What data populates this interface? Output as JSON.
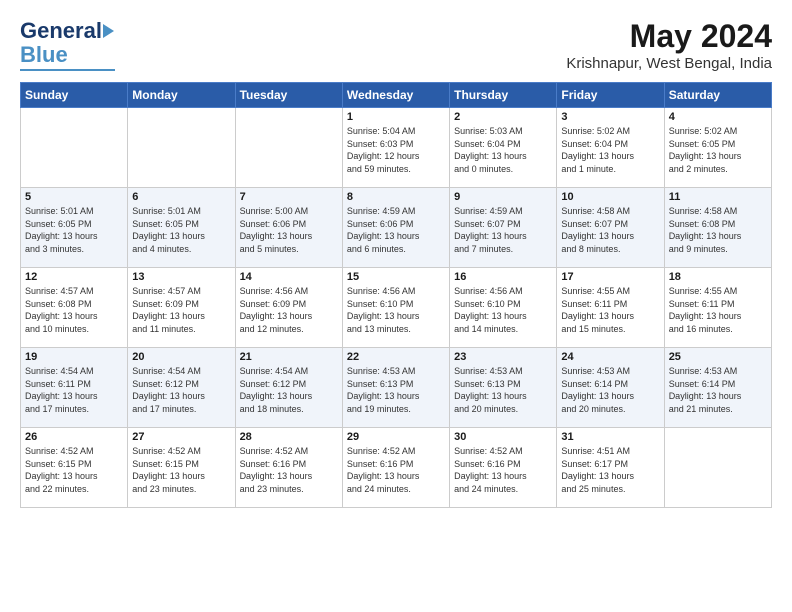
{
  "header": {
    "logo_general": "General",
    "logo_blue": "Blue",
    "title": "May 2024",
    "subtitle": "Krishnapur, West Bengal, India"
  },
  "weekdays": [
    "Sunday",
    "Monday",
    "Tuesday",
    "Wednesday",
    "Thursday",
    "Friday",
    "Saturday"
  ],
  "weeks": [
    [
      {
        "day": "",
        "info": ""
      },
      {
        "day": "",
        "info": ""
      },
      {
        "day": "",
        "info": ""
      },
      {
        "day": "1",
        "info": "Sunrise: 5:04 AM\nSunset: 6:03 PM\nDaylight: 12 hours\nand 59 minutes."
      },
      {
        "day": "2",
        "info": "Sunrise: 5:03 AM\nSunset: 6:04 PM\nDaylight: 13 hours\nand 0 minutes."
      },
      {
        "day": "3",
        "info": "Sunrise: 5:02 AM\nSunset: 6:04 PM\nDaylight: 13 hours\nand 1 minute."
      },
      {
        "day": "4",
        "info": "Sunrise: 5:02 AM\nSunset: 6:05 PM\nDaylight: 13 hours\nand 2 minutes."
      }
    ],
    [
      {
        "day": "5",
        "info": "Sunrise: 5:01 AM\nSunset: 6:05 PM\nDaylight: 13 hours\nand 3 minutes."
      },
      {
        "day": "6",
        "info": "Sunrise: 5:01 AM\nSunset: 6:05 PM\nDaylight: 13 hours\nand 4 minutes."
      },
      {
        "day": "7",
        "info": "Sunrise: 5:00 AM\nSunset: 6:06 PM\nDaylight: 13 hours\nand 5 minutes."
      },
      {
        "day": "8",
        "info": "Sunrise: 4:59 AM\nSunset: 6:06 PM\nDaylight: 13 hours\nand 6 minutes."
      },
      {
        "day": "9",
        "info": "Sunrise: 4:59 AM\nSunset: 6:07 PM\nDaylight: 13 hours\nand 7 minutes."
      },
      {
        "day": "10",
        "info": "Sunrise: 4:58 AM\nSunset: 6:07 PM\nDaylight: 13 hours\nand 8 minutes."
      },
      {
        "day": "11",
        "info": "Sunrise: 4:58 AM\nSunset: 6:08 PM\nDaylight: 13 hours\nand 9 minutes."
      }
    ],
    [
      {
        "day": "12",
        "info": "Sunrise: 4:57 AM\nSunset: 6:08 PM\nDaylight: 13 hours\nand 10 minutes."
      },
      {
        "day": "13",
        "info": "Sunrise: 4:57 AM\nSunset: 6:09 PM\nDaylight: 13 hours\nand 11 minutes."
      },
      {
        "day": "14",
        "info": "Sunrise: 4:56 AM\nSunset: 6:09 PM\nDaylight: 13 hours\nand 12 minutes."
      },
      {
        "day": "15",
        "info": "Sunrise: 4:56 AM\nSunset: 6:10 PM\nDaylight: 13 hours\nand 13 minutes."
      },
      {
        "day": "16",
        "info": "Sunrise: 4:56 AM\nSunset: 6:10 PM\nDaylight: 13 hours\nand 14 minutes."
      },
      {
        "day": "17",
        "info": "Sunrise: 4:55 AM\nSunset: 6:11 PM\nDaylight: 13 hours\nand 15 minutes."
      },
      {
        "day": "18",
        "info": "Sunrise: 4:55 AM\nSunset: 6:11 PM\nDaylight: 13 hours\nand 16 minutes."
      }
    ],
    [
      {
        "day": "19",
        "info": "Sunrise: 4:54 AM\nSunset: 6:11 PM\nDaylight: 13 hours\nand 17 minutes."
      },
      {
        "day": "20",
        "info": "Sunrise: 4:54 AM\nSunset: 6:12 PM\nDaylight: 13 hours\nand 17 minutes."
      },
      {
        "day": "21",
        "info": "Sunrise: 4:54 AM\nSunset: 6:12 PM\nDaylight: 13 hours\nand 18 minutes."
      },
      {
        "day": "22",
        "info": "Sunrise: 4:53 AM\nSunset: 6:13 PM\nDaylight: 13 hours\nand 19 minutes."
      },
      {
        "day": "23",
        "info": "Sunrise: 4:53 AM\nSunset: 6:13 PM\nDaylight: 13 hours\nand 20 minutes."
      },
      {
        "day": "24",
        "info": "Sunrise: 4:53 AM\nSunset: 6:14 PM\nDaylight: 13 hours\nand 20 minutes."
      },
      {
        "day": "25",
        "info": "Sunrise: 4:53 AM\nSunset: 6:14 PM\nDaylight: 13 hours\nand 21 minutes."
      }
    ],
    [
      {
        "day": "26",
        "info": "Sunrise: 4:52 AM\nSunset: 6:15 PM\nDaylight: 13 hours\nand 22 minutes."
      },
      {
        "day": "27",
        "info": "Sunrise: 4:52 AM\nSunset: 6:15 PM\nDaylight: 13 hours\nand 23 minutes."
      },
      {
        "day": "28",
        "info": "Sunrise: 4:52 AM\nSunset: 6:16 PM\nDaylight: 13 hours\nand 23 minutes."
      },
      {
        "day": "29",
        "info": "Sunrise: 4:52 AM\nSunset: 6:16 PM\nDaylight: 13 hours\nand 24 minutes."
      },
      {
        "day": "30",
        "info": "Sunrise: 4:52 AM\nSunset: 6:16 PM\nDaylight: 13 hours\nand 24 minutes."
      },
      {
        "day": "31",
        "info": "Sunrise: 4:51 AM\nSunset: 6:17 PM\nDaylight: 13 hours\nand 25 minutes."
      },
      {
        "day": "",
        "info": ""
      }
    ]
  ]
}
